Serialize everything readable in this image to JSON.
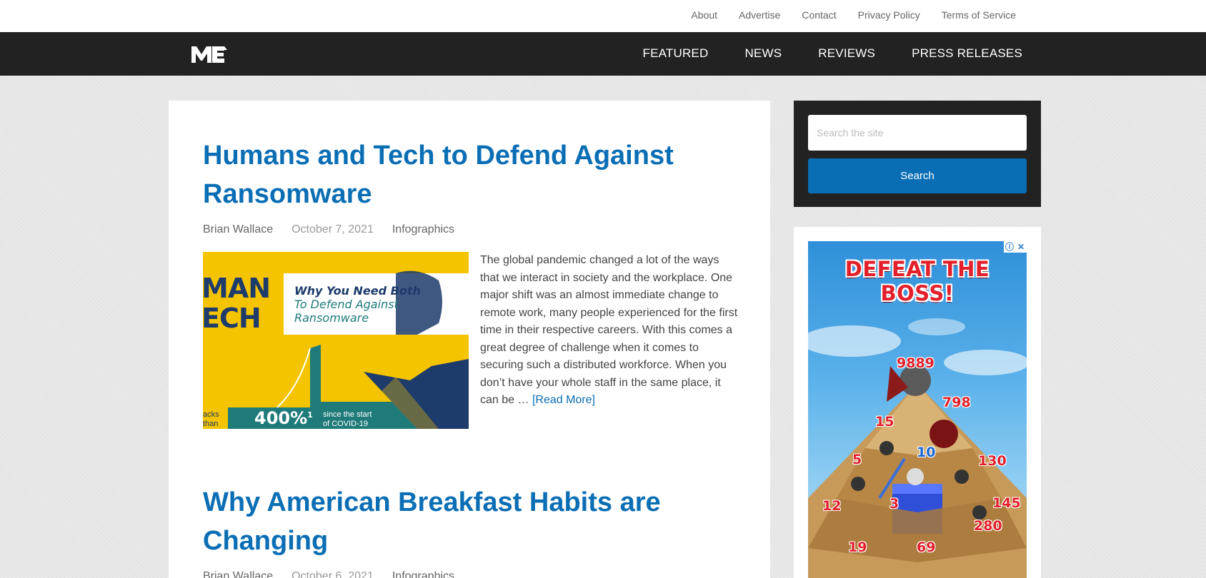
{
  "top_nav": [
    "About",
    "Advertise",
    "Contact",
    "Privacy Policy",
    "Terms of Service"
  ],
  "logo": "ME",
  "main_nav": [
    "FEATURED",
    "NEWS",
    "REVIEWS",
    "PRESS RELEASES"
  ],
  "posts": [
    {
      "title": "Humans and Tech to Defend Against Ransomware",
      "author": "Brian Wallace",
      "date": "October 7, 2021",
      "category": "Infographics",
      "thumbnail": {
        "big_text_1": "MAN",
        "big_text_2": "ECH",
        "headline_1": "Why You Need Both",
        "headline_2": "To Defend Against",
        "headline_3": "Ransomware",
        "stat": "400%",
        "stat_sup": "1",
        "stat_caption_1": "since the start",
        "stat_caption_2": "of COVID-19",
        "left_caption_1": "acks",
        "left_caption_2": "than"
      },
      "excerpt": "The global pandemic changed a lot of the ways that we interact in society and the workplace. One major shift was an almost immediate change to remote work, many people experienced for the first time in their respective careers.  With this comes a great degree of challenge when it comes to securing such a distributed workforce. When you don’t have your whole staff in the same place, it can be …",
      "read_more": "[Read More]"
    },
    {
      "title": "Why American Breakfast Habits are Changing",
      "author": "Brian Wallace",
      "date": "October 6, 2021",
      "category": "Infographics"
    }
  ],
  "search": {
    "placeholder": "Search the site",
    "button_label": "Search"
  },
  "ad": {
    "title": "DEFEAT THE BOSS!",
    "numbers": [
      "9889",
      "798",
      "15",
      "5",
      "10",
      "130",
      "12",
      "3",
      "145",
      "19",
      "69",
      "280"
    ],
    "colors": {
      "title": "#e3202a",
      "blue_number": "#1a66d6"
    }
  },
  "colors": {
    "link": "#0a6eb5",
    "header_bg": "#222222",
    "search_button": "#0a6eb5"
  }
}
